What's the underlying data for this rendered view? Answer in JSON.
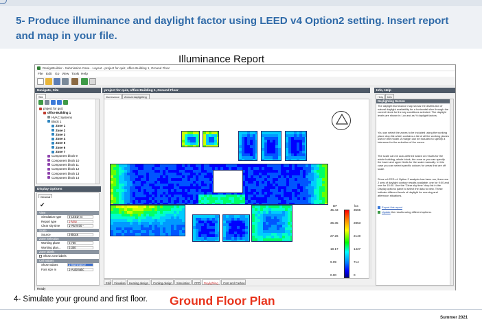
{
  "slide": {
    "title": "5- Produce illuminance and daylight factor using LEED v4 Option2 setting. Insert report and map in your file.",
    "report_heading": "Illuminance Report",
    "footnote": "4- Simulate your ground and first floor.",
    "plan_label": "Ground Floor Plan",
    "date": "Summer 2021"
  },
  "app": {
    "window_title": "DesignBuilder - Submission Case - Layout - project for quiz, office Building 1, Ground Floor",
    "menu": [
      "File",
      "Edit",
      "Go",
      "View",
      "Tools",
      "Help"
    ],
    "status": "Ready"
  },
  "navigate": {
    "header": "Navigate, Site",
    "tab": "Site",
    "tree": [
      {
        "label": "project for quiz",
        "level": 0,
        "bold": false,
        "color": "#c0392b"
      },
      {
        "label": "office Building 1",
        "level": 1,
        "bold": true,
        "color": "#c0392b"
      },
      {
        "label": "HVAC Systems",
        "level": 2,
        "bold": false,
        "color": "#7f8c8d"
      },
      {
        "label": "Block 1",
        "level": 2,
        "bold": false,
        "color": "#2e86c1"
      },
      {
        "label": "Zone 1",
        "level": 3,
        "bold": true,
        "color": "#2e86c1"
      },
      {
        "label": "Zone 2",
        "level": 3,
        "bold": true,
        "color": "#2e86c1"
      },
      {
        "label": "Zone 3",
        "level": 3,
        "bold": true,
        "color": "#2e86c1"
      },
      {
        "label": "Zone 4",
        "level": 3,
        "bold": true,
        "color": "#2e86c1"
      },
      {
        "label": "Zone 5",
        "level": 3,
        "bold": true,
        "color": "#2e86c1"
      },
      {
        "label": "Zone 6",
        "level": 3,
        "bold": true,
        "color": "#2e86c1"
      },
      {
        "label": "Zone 7",
        "level": 3,
        "bold": true,
        "color": "#2e86c1"
      },
      {
        "label": "Component block 9",
        "level": 2,
        "bold": false,
        "color": "#8e44ad"
      },
      {
        "label": "Component block 10",
        "level": 2,
        "bold": false,
        "color": "#8e44ad"
      },
      {
        "label": "Component block 11",
        "level": 2,
        "bold": false,
        "color": "#8e44ad"
      },
      {
        "label": "Component block 12",
        "level": 2,
        "bold": false,
        "color": "#8e44ad"
      },
      {
        "label": "Component block 13",
        "level": 2,
        "bold": false,
        "color": "#8e44ad"
      },
      {
        "label": "Component block 14",
        "level": 2,
        "bold": false,
        "color": "#8e44ad"
      }
    ]
  },
  "display_options": {
    "header": "Display Options",
    "tab": "General",
    "sections": {
      "view": "View",
      "scale": "Scale",
      "zone_selection": "Zone Selection",
      "zone_labels": "Zone labels",
      "cell_values": "Cell Values"
    },
    "rows": {
      "simulation_type_label": "Simulation type",
      "simulation_type_value": "4-LEED v4",
      "report_type_label": "Report type",
      "report_type_value": "1-Map",
      "clear_sky_label": "Clear sky time",
      "clear_sky_value": "1-AM 9:00 -",
      "source_label": "Source",
      "source_value": "2-Block",
      "working_plane_label": "Working plane",
      "working_plane_value": "0.750",
      "working_plane2_label": "Working plan...",
      "working_plane2_value": "0.300",
      "show_zone_labels": "Show zone labels",
      "show_values_label": "Show values",
      "show_values_value": "1-Illuminance",
      "font_size_label": "Font size m",
      "font_size_value": "1-Automatic"
    }
  },
  "center": {
    "header": "project for quiz, office Building 1, Ground Floor",
    "top_tabs": [
      "Illuminance",
      "Annual daylighting"
    ],
    "bottom_tabs": [
      "Edit",
      "Visualise",
      "Heating design",
      "Cooling design",
      "Simulation",
      "CFD",
      "Daylighting",
      "Cost and Carbon"
    ],
    "active_bottom_tab": "Daylighting"
  },
  "legend": {
    "df_header": "DF",
    "lux_header": "lux",
    "rows": [
      {
        "df": "45.43",
        "lux": "3566"
      },
      {
        "df": "36.35",
        "lux": "2853"
      },
      {
        "df": "27.26",
        "lux": "2140"
      },
      {
        "df": "18.17",
        "lux": "1427"
      },
      {
        "df": "9.09",
        "lux": "714"
      },
      {
        "df": "0.00",
        "lux": "0"
      }
    ]
  },
  "info": {
    "header": "Info, Help",
    "tabs": [
      "Help",
      "Info"
    ],
    "title": "Daylighting Screen",
    "paragraphs": [
      "The daylight illuminance map shows the distribution of natural daylight availability for a horizontal slice through the current block for the sky conditions selected. The daylight levels are shown in Lux and as % daylight factors.",
      "You can select the zones to be included using the working plane drop list which contains a list of all the working planes used in the model. A margin can be included to specify a tolerance for the selection of the zones.",
      "The scale can be auto-defined based on results for the whole building, whole block, the zone or you can specify the lower and upper limits for the scale manually. In this case you can select specific colours for areas that are off scale.",
      "Since a LEED v4 Option 2 analysis has been run, there are 2 sets of daylight contour results available, one for 9:00 and one for 15:00. Use the 'Clear sky time' drop list in the Display options panel to select the data to view. These indicate different levels of daylight for morning and afternoon situations."
    ],
    "link1": "Export this report",
    "link2_prefix": "Update",
    "link2_rest": "the results using different options."
  },
  "colors": {
    "title_blue": "#2f6aa8",
    "plan_red": "#e8331b",
    "panel_header": "#4f5a67"
  }
}
